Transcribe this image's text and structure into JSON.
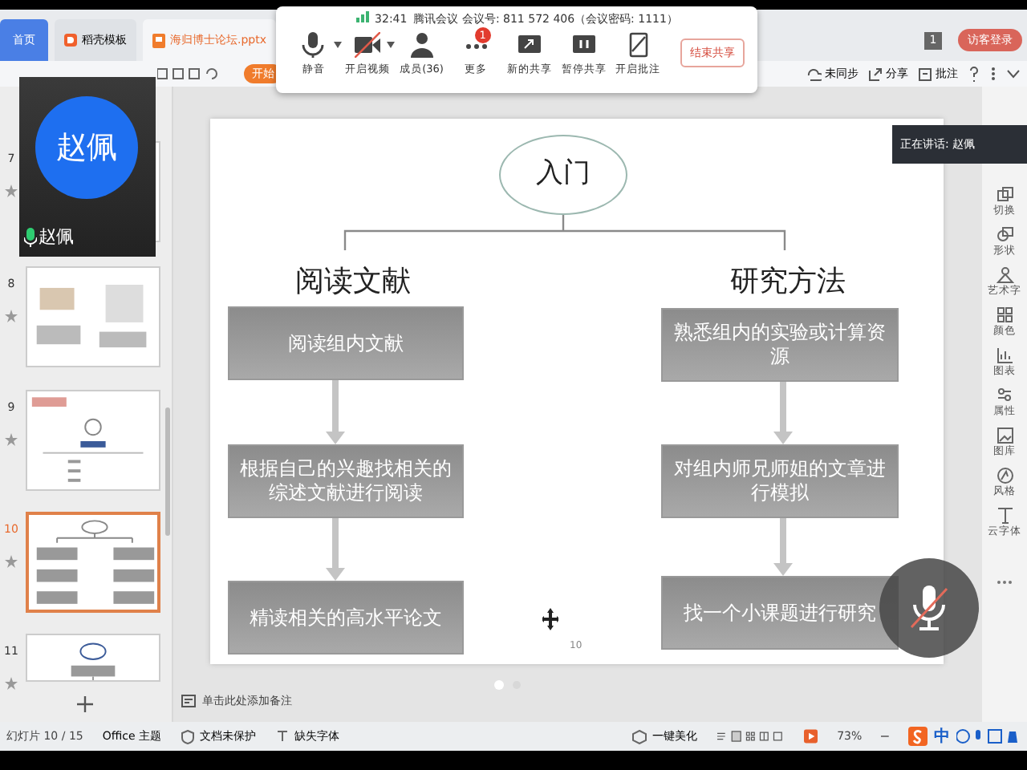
{
  "app_tabs": [
    {
      "label": "首页",
      "kind": "home",
      "selected": false
    },
    {
      "label": "稻壳模板",
      "kind": "docer",
      "selected": false
    },
    {
      "label": "海归博士论坛.pptx",
      "kind": "file",
      "selected": true
    }
  ],
  "account": {
    "badge": "1",
    "login": "访客登录"
  },
  "ribbon": {
    "start_button": "开始",
    "right_items": [
      {
        "label": "未同步",
        "kind": "sync"
      },
      {
        "label": "分享",
        "kind": "share"
      },
      {
        "label": "批注",
        "kind": "comment"
      }
    ]
  },
  "meeting": {
    "timer": "32:41",
    "info": "腾讯会议 会议号: 811 572 406（会议密码: 1111）",
    "controls": [
      {
        "label": "静音",
        "kind": "mic",
        "dropdown": true
      },
      {
        "label": "开启视频",
        "kind": "video",
        "dropdown": true
      },
      {
        "label": "成员(36)",
        "kind": "members",
        "dropdown": false
      },
      {
        "label": "更多",
        "kind": "more",
        "dropdown": false,
        "badge": "1"
      },
      {
        "label": "新的共享",
        "kind": "share",
        "dropdown": false
      },
      {
        "label": "暂停共享",
        "kind": "pause",
        "dropdown": false
      },
      {
        "label": "开启批注",
        "kind": "annotate",
        "dropdown": false
      }
    ],
    "end_button": "结束共享"
  },
  "video_tile": {
    "avatar_text": "赵佩",
    "name": "赵佩"
  },
  "speaking": "正在讲话: 赵佩",
  "thumbnails": [
    {
      "number": "7",
      "kind": "blank",
      "selected": false
    },
    {
      "number": "8",
      "kind": "figures",
      "selected": false
    },
    {
      "number": "9",
      "kind": "title",
      "selected": false
    },
    {
      "number": "10",
      "kind": "flow",
      "selected": true
    },
    {
      "number": "11",
      "kind": "chain",
      "selected": false
    }
  ],
  "slide": {
    "root": "入门",
    "branches": [
      {
        "heading": "阅读文献",
        "steps": [
          "阅读组内文献",
          "根据自己的兴趣找相关的综述文献进行阅读",
          "精读相关的高水平论文"
        ]
      },
      {
        "heading": "研究方法",
        "steps": [
          "熟悉组内的实验或计算资源",
          "对组内师兄师姐的文章进行模拟",
          "找一个小课题进行研究"
        ]
      }
    ],
    "page_number": "10"
  },
  "notes_placeholder": "单击此处添加备注",
  "right_panel": [
    {
      "label": "切换",
      "kind": "switch"
    },
    {
      "label": "形状",
      "kind": "shape"
    },
    {
      "label": "艺术字",
      "kind": "art"
    },
    {
      "label": "颜色",
      "kind": "color"
    },
    {
      "label": "图表",
      "kind": "chart"
    },
    {
      "label": "属性",
      "kind": "props"
    },
    {
      "label": "图库",
      "kind": "gallery"
    },
    {
      "label": "风格",
      "kind": "style"
    },
    {
      "label": "云字体",
      "kind": "font"
    }
  ],
  "status_bar": {
    "slide": "幻灯片 10 / 15",
    "theme": "Office 主题",
    "protect": "文档未保护",
    "fonts": "缺失字体",
    "beautify": "一键美化",
    "zoom": "73%"
  },
  "ime": {
    "lang": "中"
  },
  "mute_overlay": {
    "muted": true
  }
}
